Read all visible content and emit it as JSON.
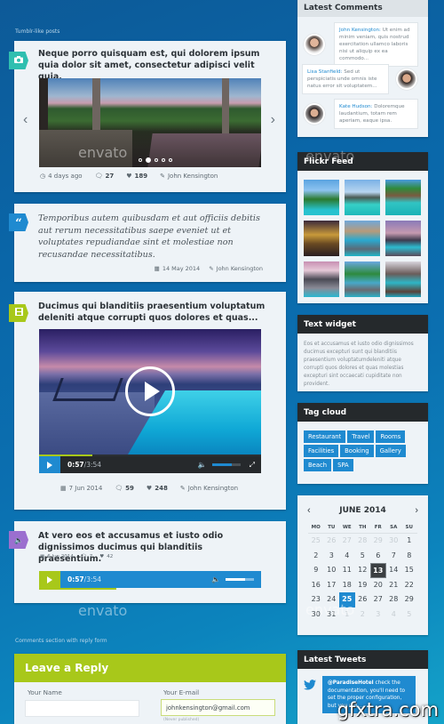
{
  "sections": {
    "tumblr_label": "Tumblr-like posts",
    "comments_label": "Comments section with reply form"
  },
  "posts": [
    {
      "type": "image-slider",
      "badge_icon": "camera-icon",
      "badge_color": "#2fbfb0",
      "title": "Neque porro quisquam est, qui dolorem ipsum quia dolor sit amet, consectetur adipisci velit quia.",
      "slides_total": 5,
      "active_slide": 2,
      "meta": {
        "time": "4 days ago",
        "comments": "27",
        "likes": "189",
        "author": "John Kensington"
      }
    },
    {
      "type": "quote",
      "badge_icon": "quote-icon",
      "badge_color": "#1f8ad0",
      "quote": "Temporibus autem quibusdam et aut officiis debitis aut rerum necessitatibus saepe eveniet ut et voluptates repudiandae sint et molestiae non recusandae necessitatibus.",
      "meta": {
        "date": "14 May 2014",
        "author": "John Kensington"
      }
    },
    {
      "type": "video",
      "badge_icon": "film-icon",
      "badge_color": "#a8c81a",
      "title": "Ducimus qui blanditiis praesentium voluptatum deleniti atque corrupti quos dolores et quas...",
      "player": {
        "current": "0:57",
        "separator": " / ",
        "duration": "3:54",
        "progress": 0.24,
        "volume": 0.7
      },
      "meta": {
        "date": "7 Jun 2014",
        "comments": "59",
        "likes": "248",
        "author": "John Kensington"
      }
    },
    {
      "type": "audio",
      "badge_icon": "speaker-icon",
      "badge_color": "#9b6fcf",
      "title": "At vero eos et accusamus et iusto odio dignissimos ducimus qui blanditiis praesentium.",
      "player": {
        "current": "0:57",
        "separator": " / ",
        "duration": "3:54",
        "progress": 0.24,
        "volume": 0.7
      },
      "meta": {
        "date": "6 Jun 2014",
        "comments": "7",
        "likes": "42"
      }
    }
  ],
  "reply_form": {
    "title": "Leave a Reply",
    "name_label": "Your Name",
    "name_value": "",
    "email_label": "Your E-mail",
    "email_value": "johnkensington@gmail.com",
    "email_hint": "(Never published)"
  },
  "sidebar": {
    "latest_comments": {
      "title": "Latest Comments",
      "items": [
        {
          "name": "John Kensington:",
          "text": " Ut enim ad minim veniam, quis nostrud exercitation ullamco laboris nisi ut aliquip ex ea commodo...",
          "side": "left"
        },
        {
          "name": "Lisa Stanfield:",
          "text": " Sed ut perspiciatis unde omnis iste natus error sit voluptatem...",
          "side": "right"
        },
        {
          "name": "Kate Hudson:",
          "text": " Doloremque laudantium, totam rem aperiam, eaque ipsa.",
          "side": "left"
        }
      ]
    },
    "flickr": {
      "title": "Flickr Feed",
      "photos": [
        "palm-beach",
        "overwater-bungalows",
        "resort-pool",
        "night-lounge",
        "bungalow-walkway",
        "sunset-palms",
        "pink-sky-deck",
        "jetty-bridge",
        "pool-terrace"
      ]
    },
    "text_widget": {
      "title": "Text widget",
      "body": "Eos et accusamus et iusto odio dignissimos ducimus excepturi sunt qui blanditiis praesentium voluptatumdeleniti atque corrupti quos dolores et quas molestias excepturi sint occaecati cupiditate non provident."
    },
    "tag_cloud": {
      "title": "Tag cloud",
      "tags": [
        "Restaurant",
        "Travel",
        "Rooms",
        "Facilities",
        "Booking",
        "Gallery",
        "Beach",
        "SPA"
      ]
    },
    "calendar": {
      "month_label": "JUNE 2014",
      "prev": "‹",
      "next": "›",
      "weekdays": [
        "MO",
        "TU",
        "WE",
        "TH",
        "FR",
        "SA",
        "SU"
      ],
      "days": [
        {
          "d": "25",
          "m": true
        },
        {
          "d": "26",
          "m": true
        },
        {
          "d": "27",
          "m": true
        },
        {
          "d": "28",
          "m": true
        },
        {
          "d": "29",
          "m": true
        },
        {
          "d": "30",
          "m": true
        },
        {
          "d": "1"
        },
        {
          "d": "2"
        },
        {
          "d": "3"
        },
        {
          "d": "4"
        },
        {
          "d": "5"
        },
        {
          "d": "6"
        },
        {
          "d": "7"
        },
        {
          "d": "8"
        },
        {
          "d": "9"
        },
        {
          "d": "10"
        },
        {
          "d": "11"
        },
        {
          "d": "12"
        },
        {
          "d": "13",
          "today": true
        },
        {
          "d": "14"
        },
        {
          "d": "15"
        },
        {
          "d": "16"
        },
        {
          "d": "17"
        },
        {
          "d": "18"
        },
        {
          "d": "19"
        },
        {
          "d": "20"
        },
        {
          "d": "21"
        },
        {
          "d": "22"
        },
        {
          "d": "23"
        },
        {
          "d": "24"
        },
        {
          "d": "25",
          "selected": true
        },
        {
          "d": "26"
        },
        {
          "d": "27"
        },
        {
          "d": "28"
        },
        {
          "d": "29"
        },
        {
          "d": "30"
        },
        {
          "d": "31"
        },
        {
          "d": "1",
          "m": true
        },
        {
          "d": "2",
          "m": true
        },
        {
          "d": "3",
          "m": true
        },
        {
          "d": "4",
          "m": true
        },
        {
          "d": "5",
          "m": true
        }
      ]
    },
    "latest_tweets": {
      "title": "Latest Tweets",
      "items": [
        {
          "handle": "@ParadiseHotel",
          "text": " check the documentation, you'll need to set the proper configuration, but you will..."
        }
      ]
    }
  },
  "watermarks": {
    "envato": "envato",
    "site": "gfxtra.com"
  },
  "colors": {
    "accent_blue": "#1f8ad0",
    "accent_green": "#a8c81a",
    "dark_head": "#25292c"
  }
}
